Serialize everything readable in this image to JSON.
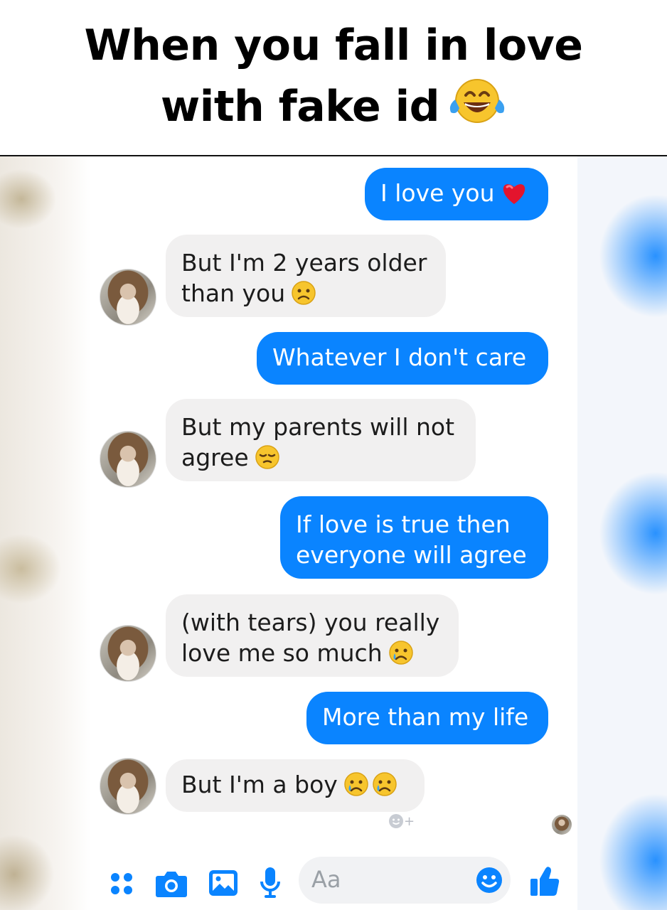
{
  "meme": {
    "title_line1": "When you fall in love",
    "title_line2": "with fake id",
    "title_emoji": "tears-of-joy-emoji"
  },
  "colors": {
    "outgoing_bubble": "#0a84ff",
    "incoming_bubble": "#f1f0f0",
    "accent": "#0a84ff"
  },
  "messages": [
    {
      "sender": "me",
      "text": "I love you",
      "emoji": "red-heart-emoji"
    },
    {
      "sender": "other",
      "text_line1": "But I'm 2 years older",
      "text_line2": "than you",
      "emoji": "confused-face-emoji"
    },
    {
      "sender": "me",
      "text": "Whatever I don't care"
    },
    {
      "sender": "other",
      "text_line1": "But my parents will not",
      "text_line2": "agree",
      "emoji": "pensive-face-emoji"
    },
    {
      "sender": "me",
      "text_line1": "If love is true then",
      "text_line2": "everyone will agree"
    },
    {
      "sender": "other",
      "text_line1": "(with tears) you really",
      "text_line2": "love me so much",
      "emoji": "crying-face-emoji"
    },
    {
      "sender": "me",
      "text": "More than my life"
    },
    {
      "sender": "other",
      "text": "But I'm a boy",
      "emoji": "crying-face-emoji-x2"
    }
  ],
  "composer": {
    "placeholder": "Aa",
    "icons": [
      "menu-dots-icon",
      "camera-icon",
      "gallery-icon",
      "microphone-icon",
      "emoji-icon",
      "thumbs-up-icon"
    ]
  },
  "reaction_hint": "+"
}
